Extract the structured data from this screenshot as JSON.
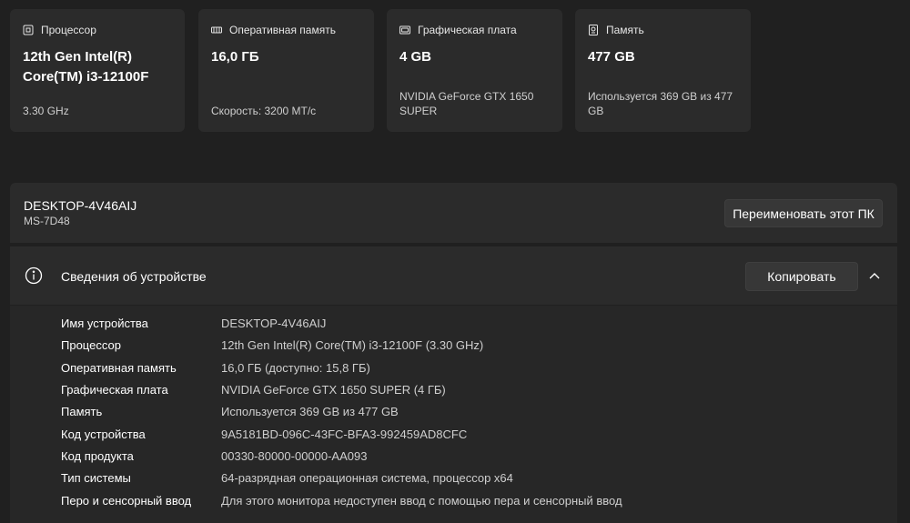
{
  "cards": [
    {
      "title": "Процессор",
      "icon": "processor-icon",
      "value": "12th Gen Intel(R) Core(TM) i3-12100F",
      "sub": "3.30 GHz"
    },
    {
      "title": "Оперативная память",
      "icon": "ram-icon",
      "value": "16,0 ГБ",
      "sub": "Скорость: 3200 МТ/с"
    },
    {
      "title": "Графическая плата",
      "icon": "graphics-card-icon",
      "value": "4 GB",
      "sub": "NVIDIA GeForce GTX 1650 SUPER"
    },
    {
      "title": "Память",
      "icon": "storage-icon",
      "value": "477 GB",
      "sub": "Используется 369 GB из 477 GB"
    }
  ],
  "device": {
    "name": "DESKTOP-4V46AIJ",
    "model": "MS-7D48",
    "rename_label": "Переименовать этот ПК"
  },
  "specs": {
    "title": "Сведения об устройстве",
    "copy_label": "Копировать",
    "rows": [
      {
        "label": "Имя устройства",
        "value": "DESKTOP-4V46AIJ"
      },
      {
        "label": "Процессор",
        "value": "12th Gen Intel(R) Core(TM) i3-12100F (3.30 GHz)"
      },
      {
        "label": "Оперативная память",
        "value": "16,0 ГБ (доступно: 15,8 ГБ)"
      },
      {
        "label": "Графическая плата",
        "value": "NVIDIA GeForce GTX 1650 SUPER (4 ГБ)"
      },
      {
        "label": "Память",
        "value": "Используется 369 GB из 477 GB"
      },
      {
        "label": "Код устройства",
        "value": "9A5181BD-096C-43FC-BFA3-992459AD8CFC"
      },
      {
        "label": "Код продукта",
        "value": "00330-80000-00000-AA093"
      },
      {
        "label": "Тип системы",
        "value": "64-разрядная операционная система, процессор x64"
      },
      {
        "label": "Перо и сенсорный ввод",
        "value": "Для этого монитора недоступен ввод с помощью пера и сенсорный ввод"
      }
    ]
  }
}
